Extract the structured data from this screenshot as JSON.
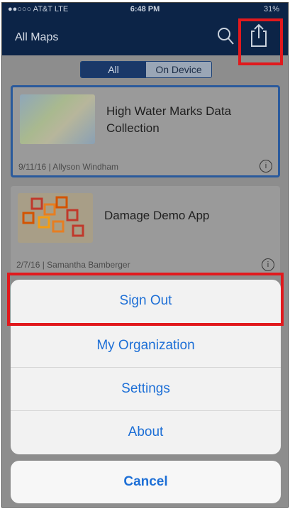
{
  "status_bar": {
    "carrier": "●●○○○ AT&T  LTE",
    "time": "6:48 PM",
    "battery": "31%"
  },
  "navbar": {
    "title": "All Maps"
  },
  "segment": {
    "all": "All",
    "on_device": "On Device"
  },
  "maps": [
    {
      "title": "High Water Marks Data Collection",
      "date": "9/11/16",
      "author": "Allyson Windham"
    },
    {
      "title": "Damage Demo App",
      "date": "2/7/16",
      "author": "Samantha Bamberger"
    }
  ],
  "action_sheet": {
    "items": [
      "Sign Out",
      "My Organization",
      "Settings",
      "About"
    ],
    "cancel": "Cancel"
  },
  "colors": {
    "highlight": "#e1191d",
    "ios_blue": "#1d6fd6",
    "nav_bg": "#0c2447"
  }
}
